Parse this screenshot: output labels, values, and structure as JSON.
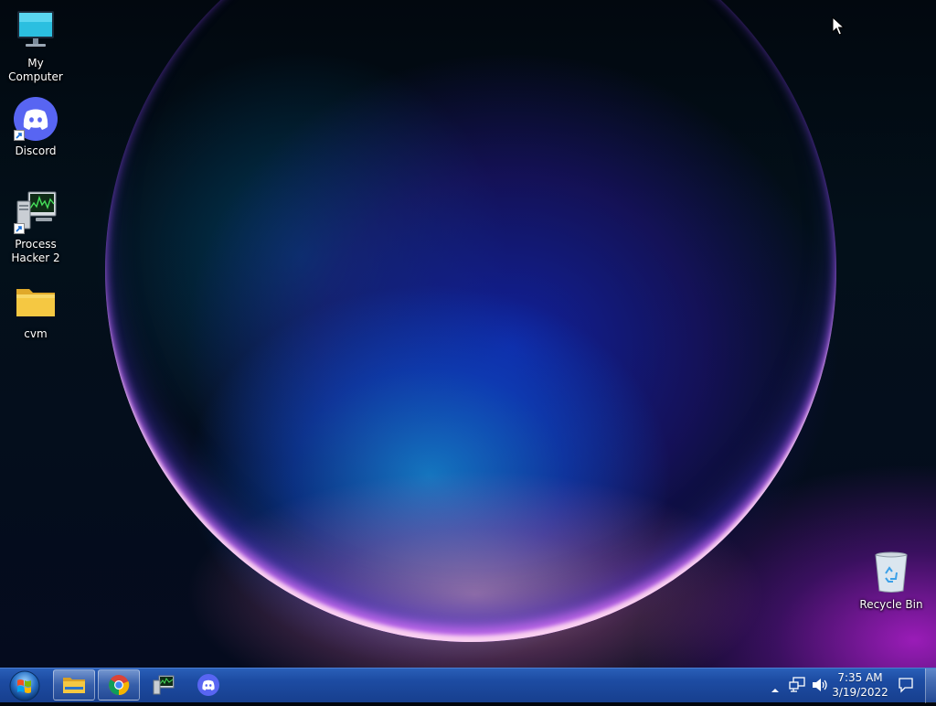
{
  "desktop": {
    "icons": [
      {
        "label": "My Computer",
        "icon": "monitor-icon"
      },
      {
        "label": "Discord",
        "icon": "discord-icon"
      },
      {
        "label": "Process Hacker 2",
        "icon": "process-hacker-icon"
      },
      {
        "label": "cvm",
        "icon": "folder-icon"
      },
      {
        "label": "Recycle Bin",
        "icon": "recycle-bin-icon"
      }
    ]
  },
  "taskbar": {
    "start_icon": "windows-orb-icon",
    "pinned": [
      {
        "name": "File Explorer",
        "icon": "folder-icon"
      },
      {
        "name": "Google Chrome",
        "icon": "chrome-icon"
      },
      {
        "name": "Process Hacker 2",
        "icon": "process-hacker-icon"
      },
      {
        "name": "Discord",
        "icon": "discord-icon"
      }
    ],
    "tray": {
      "icons": [
        "chevron-up-icon",
        "network-icon",
        "speaker-icon",
        "action-center-icon"
      ],
      "time": "7:35 AM",
      "date": "3/19/2022"
    }
  },
  "colors": {
    "taskbar": "#1d4ca3",
    "discord": "#5865F2",
    "folder": "#f5c842"
  }
}
